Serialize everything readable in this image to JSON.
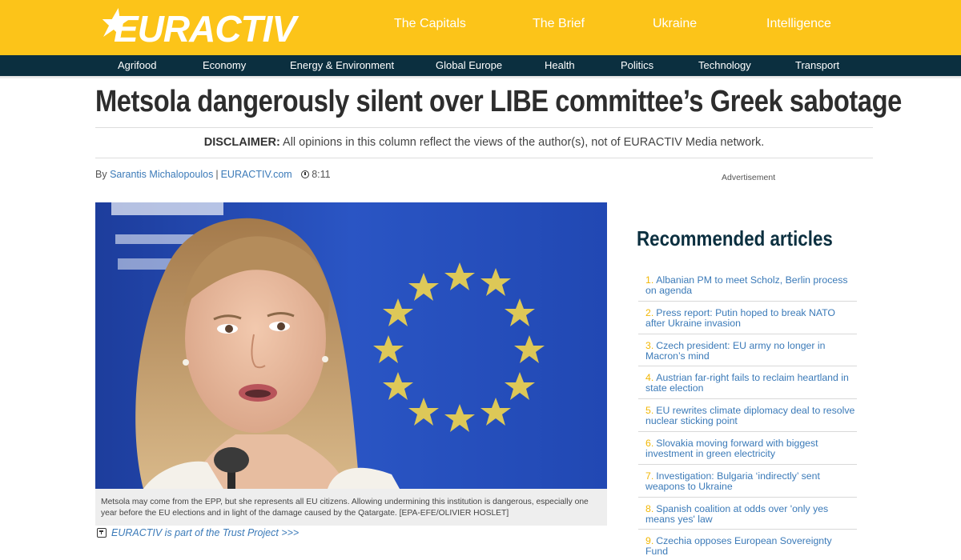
{
  "brand": {
    "logo_text": "EURACTIV",
    "yellow": "#fcc419",
    "navy": "#0b2f3f",
    "link_blue": "#3b7ab8"
  },
  "top_nav": [
    "The Capitals",
    "The Brief",
    "Ukraine",
    "Intelligence"
  ],
  "section_nav": [
    "Agrifood",
    "Economy",
    "Energy & Environment",
    "Global Europe",
    "Health",
    "Politics",
    "Technology",
    "Transport"
  ],
  "article": {
    "headline": "Metsola dangerously silent over LIBE committee’s Greek sabotage",
    "disclaimer_label": "DISCLAIMER:",
    "disclaimer_text": "All opinions in this column reflect the views of the author(s), not of EURACTIV Media network.",
    "byline_prefix": "By",
    "author": "Sarantis Michalopoulos",
    "source": "EURACTIV.com",
    "separator": "|",
    "time": "8:11",
    "caption": "Metsola may come from the EPP, but she represents all EU citizens. Allowing undermining this institution is dangerous, especially one year before the EU elections and in light of the damage caused by the Qatargate. [EPA-EFE/OLIVIER HOSLET]",
    "trust_project": "EURACTIV is part of the Trust Project >>>"
  },
  "sidebar": {
    "advertisement": "Advertisement",
    "recommended_title": "Recommended articles",
    "items": [
      {
        "num": "1.",
        "title": "Albanian PM to meet Scholz, Berlin process on agenda"
      },
      {
        "num": "2.",
        "title": "Press report: Putin hoped to break NATO after Ukraine invasion"
      },
      {
        "num": "3.",
        "title": "Czech president: EU army no longer in Macron’s mind"
      },
      {
        "num": "4.",
        "title": "Austrian far-right fails to reclaim heartland in state election"
      },
      {
        "num": "5.",
        "title": "EU rewrites climate diplomacy deal to resolve nuclear sticking point"
      },
      {
        "num": "6.",
        "title": "Slovakia moving forward with biggest investment in green electricity"
      },
      {
        "num": "7.",
        "title": "Investigation: Bulgaria ‘indirectly’ sent weapons to Ukraine"
      },
      {
        "num": "8.",
        "title": "Spanish coalition at odds over 'only yes means yes' law"
      },
      {
        "num": "9.",
        "title": "Czechia opposes European Sovereignty Fund"
      }
    ]
  }
}
